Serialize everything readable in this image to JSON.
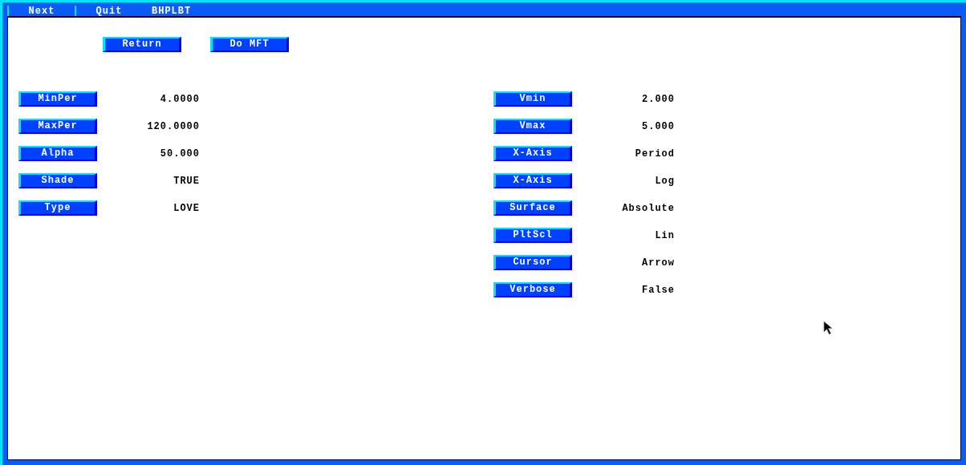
{
  "menu": [
    {
      "label": "Next"
    },
    {
      "label": "Quit"
    }
  ],
  "window": {
    "title": "BHPLBT"
  },
  "actions": [
    {
      "label": "Return"
    },
    {
      "label": "Do MFT"
    }
  ],
  "left_params": [
    {
      "label": "MinPer",
      "value": "4.0000"
    },
    {
      "label": "MaxPer",
      "value": "120.0000"
    },
    {
      "label": "Alpha",
      "value": "50.000"
    },
    {
      "label": "Shade",
      "value": "TRUE"
    },
    {
      "label": "Type",
      "value": "LOVE"
    }
  ],
  "right_params": [
    {
      "label": "Vmin",
      "value": "2.000"
    },
    {
      "label": "Vmax",
      "value": "5.000"
    },
    {
      "label": "X-Axis",
      "value": "Period"
    },
    {
      "label": "X-Axis",
      "value": "Log"
    },
    {
      "label": "Surface",
      "value": "Absolute"
    },
    {
      "label": "PltScl",
      "value": "Lin"
    },
    {
      "label": "Cursor",
      "value": "Arrow"
    },
    {
      "label": "Verbose",
      "value": "False"
    }
  ]
}
